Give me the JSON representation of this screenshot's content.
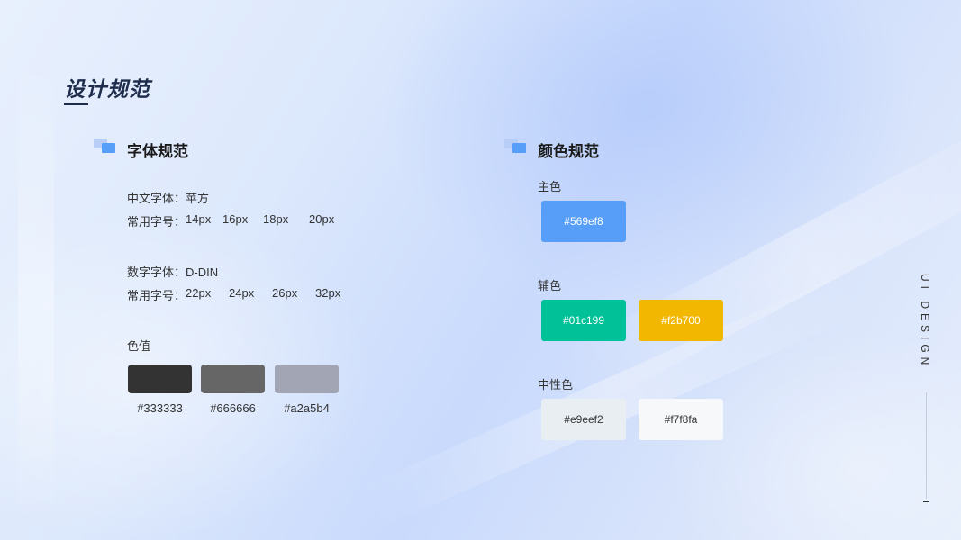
{
  "page": {
    "title": "设计规范"
  },
  "font_spec": {
    "title": "字体规范",
    "cn_font": "中文字体：苹方",
    "cn_sizes_label": "常用字号：",
    "cn_sizes": [
      "14px",
      "16px",
      "18px",
      "20px"
    ],
    "num_font": "数字字体：D-DIN",
    "num_sizes_label": "常用字号：",
    "num_sizes": [
      "22px",
      "24px",
      "26px",
      "32px"
    ],
    "color_value_label": "色值",
    "gray_swatches": [
      {
        "hex": "#333333",
        "color": "#333333"
      },
      {
        "hex": "#666666",
        "color": "#666666"
      },
      {
        "hex": "#a2a5b4",
        "color": "#a2a5b4"
      }
    ]
  },
  "color_spec": {
    "title": "颜色规范",
    "primary_label": "主色",
    "primary": [
      {
        "hex": "#569ef8",
        "color": "#569ef8",
        "text_color": "#ffffff"
      }
    ],
    "secondary_label": "辅色",
    "secondary": [
      {
        "hex": "#01c199",
        "color": "#01c199",
        "text_color": "#ffffff"
      },
      {
        "hex": "#f2b700",
        "color": "#f2b700",
        "text_color": "#ffffff"
      }
    ],
    "neutral_label": "中性色",
    "neutral": [
      {
        "hex": "#e9eef2",
        "color": "#e9eef2",
        "text_color": "#333333"
      },
      {
        "hex": "#f7f8fa",
        "color": "#f7f8fa",
        "text_color": "#333333"
      }
    ]
  },
  "side": {
    "text": "UI DESIGN"
  }
}
